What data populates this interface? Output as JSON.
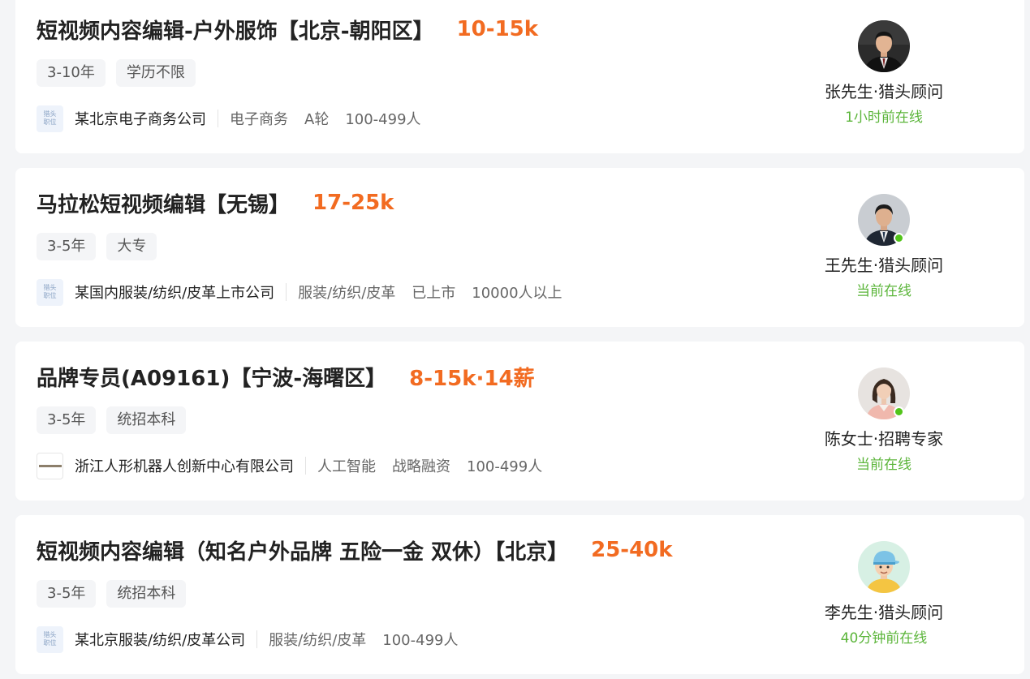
{
  "jobs": [
    {
      "title": "短视频内容编辑-户外服饰【北京-朝阳区】",
      "salary": "10-15k",
      "tags": [
        "3-10年",
        "学历不限"
      ],
      "logo_text": [
        "猎头",
        "职位"
      ],
      "company": "某北京电子商务公司",
      "meta": [
        "电子商务",
        "A轮",
        "100-499人"
      ],
      "recruiter_name": "张先生·猎头顾问",
      "recruiter_status": "1小时前在线"
    },
    {
      "title": "马拉松短视频编辑【无锡】",
      "salary": "17-25k",
      "tags": [
        "3-5年",
        "大专"
      ],
      "logo_text": [
        "猎头",
        "职位"
      ],
      "company": "某国内服装/纺织/皮革上市公司",
      "meta": [
        "服装/纺织/皮革",
        "已上市",
        "10000人以上"
      ],
      "recruiter_name": "王先生·猎头顾问",
      "recruiter_status": "当前在线"
    },
    {
      "title": "品牌专员(A09161)【宁波-海曙区】",
      "salary": "8-15k·14薪",
      "tags": [
        "3-5年",
        "统招本科"
      ],
      "company": "浙江人形机器人创新中心有限公司",
      "meta": [
        "人工智能",
        "战略融资",
        "100-499人"
      ],
      "recruiter_name": "陈女士·招聘专家",
      "recruiter_status": "当前在线"
    },
    {
      "title": "短视频内容编辑（知名户外品牌 五险一金 双休）【北京】",
      "salary": "25-40k",
      "tags": [
        "3-5年",
        "统招本科"
      ],
      "logo_text": [
        "猎头",
        "职位"
      ],
      "company": "某北京服装/纺织/皮革公司",
      "meta": [
        "服装/纺织/皮革",
        "100-499人"
      ],
      "recruiter_name": "李先生·猎头顾问",
      "recruiter_status": "40分钟前在线"
    }
  ],
  "colors": {
    "salary": "#f26b21",
    "online_status": "#5bb53a",
    "online_dot": "#52c41a",
    "background": "#f4f5f7"
  },
  "icons": {
    "avatar_1": "man-in-black-suit-avatar",
    "avatar_2": "man-in-dark-suit-avatar",
    "avatar_3": "woman-in-pink-top-avatar",
    "avatar_4": "cartoon-boy-in-cap-avatar",
    "online_indicator": "green-dot-icon"
  }
}
